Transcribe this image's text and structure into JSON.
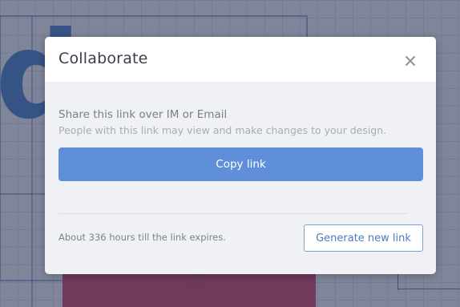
{
  "modal": {
    "title": "Collaborate",
    "close_icon": "close-icon",
    "share_heading": "Share this link over IM or Email",
    "share_description": "People with this link may view and make changes to your design.",
    "copy_button_label": "Copy link",
    "expiry_text": "About 336 hours till the link expires.",
    "generate_button_label": "Generate new link"
  },
  "colors": {
    "primary_button": "#5e8fd8",
    "secondary_button_text": "#4b7cc4",
    "overlay": "#3c4460",
    "artboard": "#c32a55",
    "grid_line": "#3d6fb5"
  },
  "background": {
    "canvas_letter": "d",
    "artboard_icon": "menu-circle-icon"
  }
}
